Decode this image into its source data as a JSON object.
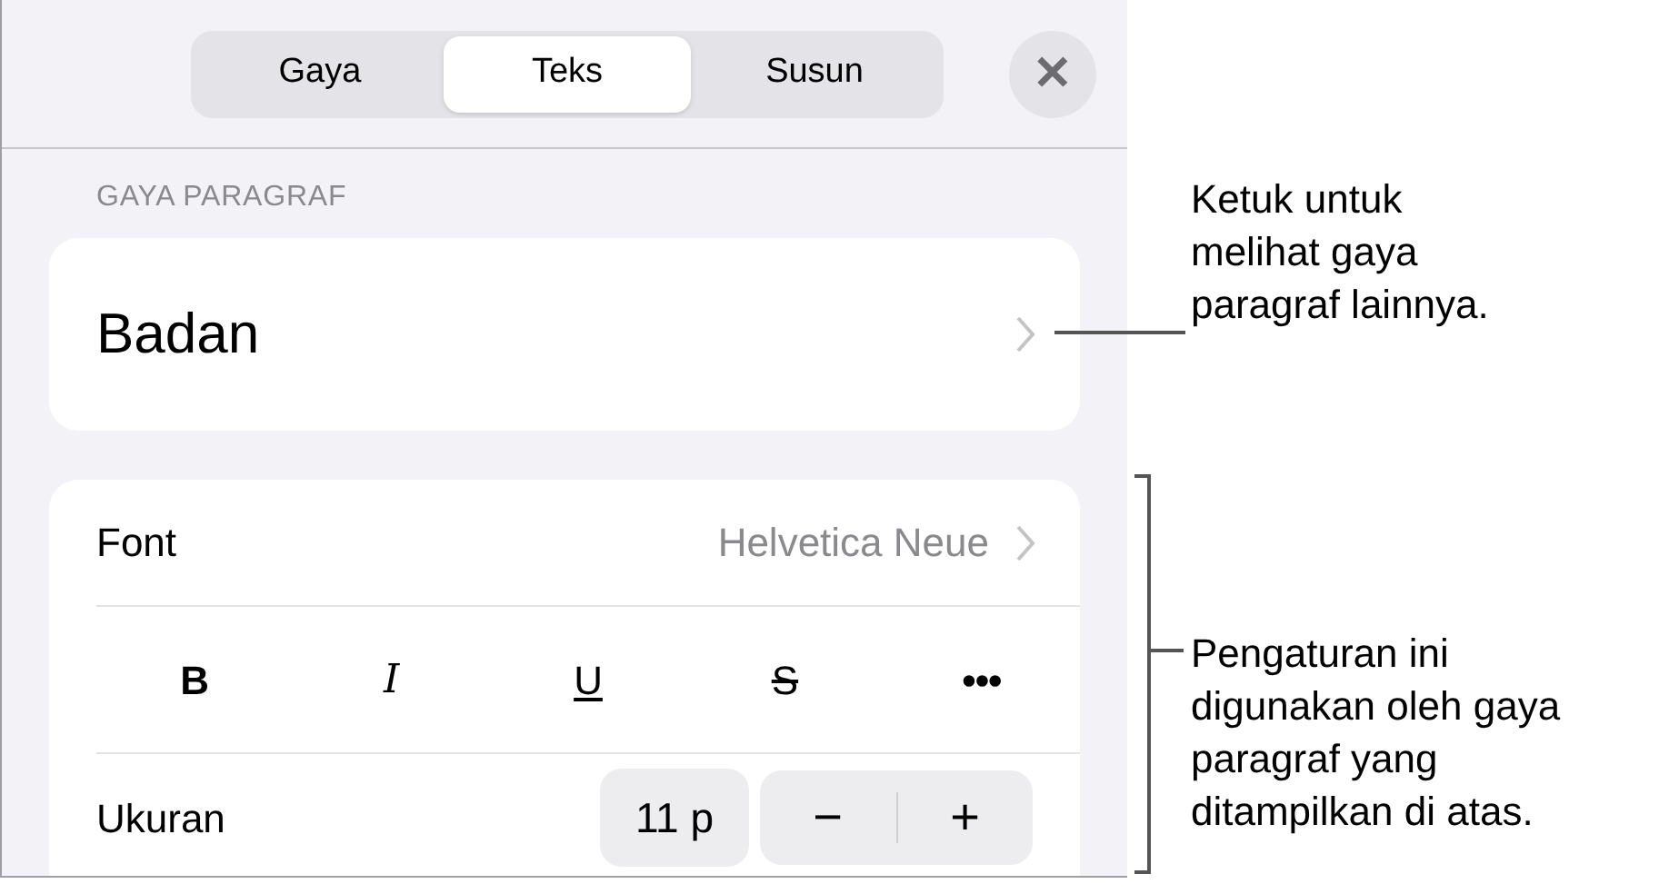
{
  "tabs": [
    {
      "label": "Gaya",
      "selected": false
    },
    {
      "label": "Teks",
      "selected": true
    },
    {
      "label": "Susun",
      "selected": false
    }
  ],
  "close": {
    "label": "✕"
  },
  "section_label": "GAYA PARAGRAF",
  "paragraph_style": {
    "value": "Badan"
  },
  "font": {
    "label": "Font",
    "value": "Helvetica Neue"
  },
  "format_buttons": [
    {
      "kind": "bold",
      "label": "B"
    },
    {
      "kind": "italic",
      "label": "I"
    },
    {
      "kind": "underline",
      "label": "U"
    },
    {
      "kind": "strike",
      "label": "S"
    },
    {
      "kind": "more",
      "label": "•••"
    }
  ],
  "size": {
    "label": "Ukuran",
    "value": "11 p",
    "decrease": "−",
    "increase": "+"
  },
  "callouts": [
    {
      "text": "Ketuk untuk melihat gaya paragraf lainnya."
    },
    {
      "text": "Pengaturan ini digunakan oleh gaya paragraf yang ditampilkan di atas."
    }
  ]
}
